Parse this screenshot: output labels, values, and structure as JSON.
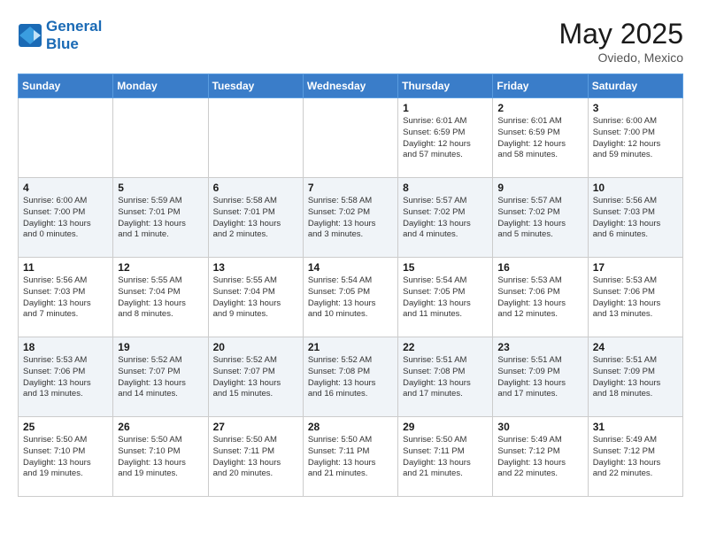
{
  "header": {
    "logo_line1": "General",
    "logo_line2": "Blue",
    "month_title": "May 2025",
    "location": "Oviedo, Mexico"
  },
  "weekdays": [
    "Sunday",
    "Monday",
    "Tuesday",
    "Wednesday",
    "Thursday",
    "Friday",
    "Saturday"
  ],
  "weeks": [
    [
      {
        "day": "",
        "info": ""
      },
      {
        "day": "",
        "info": ""
      },
      {
        "day": "",
        "info": ""
      },
      {
        "day": "",
        "info": ""
      },
      {
        "day": "1",
        "info": "Sunrise: 6:01 AM\nSunset: 6:59 PM\nDaylight: 12 hours\nand 57 minutes."
      },
      {
        "day": "2",
        "info": "Sunrise: 6:01 AM\nSunset: 6:59 PM\nDaylight: 12 hours\nand 58 minutes."
      },
      {
        "day": "3",
        "info": "Sunrise: 6:00 AM\nSunset: 7:00 PM\nDaylight: 12 hours\nand 59 minutes."
      }
    ],
    [
      {
        "day": "4",
        "info": "Sunrise: 6:00 AM\nSunset: 7:00 PM\nDaylight: 13 hours\nand 0 minutes."
      },
      {
        "day": "5",
        "info": "Sunrise: 5:59 AM\nSunset: 7:01 PM\nDaylight: 13 hours\nand 1 minute."
      },
      {
        "day": "6",
        "info": "Sunrise: 5:58 AM\nSunset: 7:01 PM\nDaylight: 13 hours\nand 2 minutes."
      },
      {
        "day": "7",
        "info": "Sunrise: 5:58 AM\nSunset: 7:02 PM\nDaylight: 13 hours\nand 3 minutes."
      },
      {
        "day": "8",
        "info": "Sunrise: 5:57 AM\nSunset: 7:02 PM\nDaylight: 13 hours\nand 4 minutes."
      },
      {
        "day": "9",
        "info": "Sunrise: 5:57 AM\nSunset: 7:02 PM\nDaylight: 13 hours\nand 5 minutes."
      },
      {
        "day": "10",
        "info": "Sunrise: 5:56 AM\nSunset: 7:03 PM\nDaylight: 13 hours\nand 6 minutes."
      }
    ],
    [
      {
        "day": "11",
        "info": "Sunrise: 5:56 AM\nSunset: 7:03 PM\nDaylight: 13 hours\nand 7 minutes."
      },
      {
        "day": "12",
        "info": "Sunrise: 5:55 AM\nSunset: 7:04 PM\nDaylight: 13 hours\nand 8 minutes."
      },
      {
        "day": "13",
        "info": "Sunrise: 5:55 AM\nSunset: 7:04 PM\nDaylight: 13 hours\nand 9 minutes."
      },
      {
        "day": "14",
        "info": "Sunrise: 5:54 AM\nSunset: 7:05 PM\nDaylight: 13 hours\nand 10 minutes."
      },
      {
        "day": "15",
        "info": "Sunrise: 5:54 AM\nSunset: 7:05 PM\nDaylight: 13 hours\nand 11 minutes."
      },
      {
        "day": "16",
        "info": "Sunrise: 5:53 AM\nSunset: 7:06 PM\nDaylight: 13 hours\nand 12 minutes."
      },
      {
        "day": "17",
        "info": "Sunrise: 5:53 AM\nSunset: 7:06 PM\nDaylight: 13 hours\nand 13 minutes."
      }
    ],
    [
      {
        "day": "18",
        "info": "Sunrise: 5:53 AM\nSunset: 7:06 PM\nDaylight: 13 hours\nand 13 minutes."
      },
      {
        "day": "19",
        "info": "Sunrise: 5:52 AM\nSunset: 7:07 PM\nDaylight: 13 hours\nand 14 minutes."
      },
      {
        "day": "20",
        "info": "Sunrise: 5:52 AM\nSunset: 7:07 PM\nDaylight: 13 hours\nand 15 minutes."
      },
      {
        "day": "21",
        "info": "Sunrise: 5:52 AM\nSunset: 7:08 PM\nDaylight: 13 hours\nand 16 minutes."
      },
      {
        "day": "22",
        "info": "Sunrise: 5:51 AM\nSunset: 7:08 PM\nDaylight: 13 hours\nand 17 minutes."
      },
      {
        "day": "23",
        "info": "Sunrise: 5:51 AM\nSunset: 7:09 PM\nDaylight: 13 hours\nand 17 minutes."
      },
      {
        "day": "24",
        "info": "Sunrise: 5:51 AM\nSunset: 7:09 PM\nDaylight: 13 hours\nand 18 minutes."
      }
    ],
    [
      {
        "day": "25",
        "info": "Sunrise: 5:50 AM\nSunset: 7:10 PM\nDaylight: 13 hours\nand 19 minutes."
      },
      {
        "day": "26",
        "info": "Sunrise: 5:50 AM\nSunset: 7:10 PM\nDaylight: 13 hours\nand 19 minutes."
      },
      {
        "day": "27",
        "info": "Sunrise: 5:50 AM\nSunset: 7:11 PM\nDaylight: 13 hours\nand 20 minutes."
      },
      {
        "day": "28",
        "info": "Sunrise: 5:50 AM\nSunset: 7:11 PM\nDaylight: 13 hours\nand 21 minutes."
      },
      {
        "day": "29",
        "info": "Sunrise: 5:50 AM\nSunset: 7:11 PM\nDaylight: 13 hours\nand 21 minutes."
      },
      {
        "day": "30",
        "info": "Sunrise: 5:49 AM\nSunset: 7:12 PM\nDaylight: 13 hours\nand 22 minutes."
      },
      {
        "day": "31",
        "info": "Sunrise: 5:49 AM\nSunset: 7:12 PM\nDaylight: 13 hours\nand 22 minutes."
      }
    ]
  ]
}
